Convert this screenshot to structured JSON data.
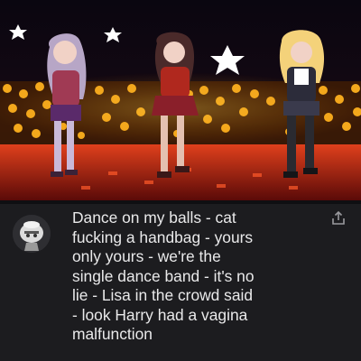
{
  "video": {
    "scene": "three-anime-dancers-on-stage",
    "icons": [
      "star-icon",
      "dancer-figure",
      "stage-lights"
    ]
  },
  "comment": {
    "avatar_icon": "cartoon-character-avatar",
    "text": "Dance on my balls - cat\nfucking a handbag - yours\nonly yours - we're the\nsingle dance band - it's no\nlie - Lisa in the crowd said\n- look Harry had a vagina\nmalfunction",
    "share_icon": "share-icon"
  },
  "colors": {
    "background": "#1c1c1f",
    "text": "#e9e9ea",
    "stage_lights": "#ffb21e",
    "floor": "#c0261a"
  }
}
